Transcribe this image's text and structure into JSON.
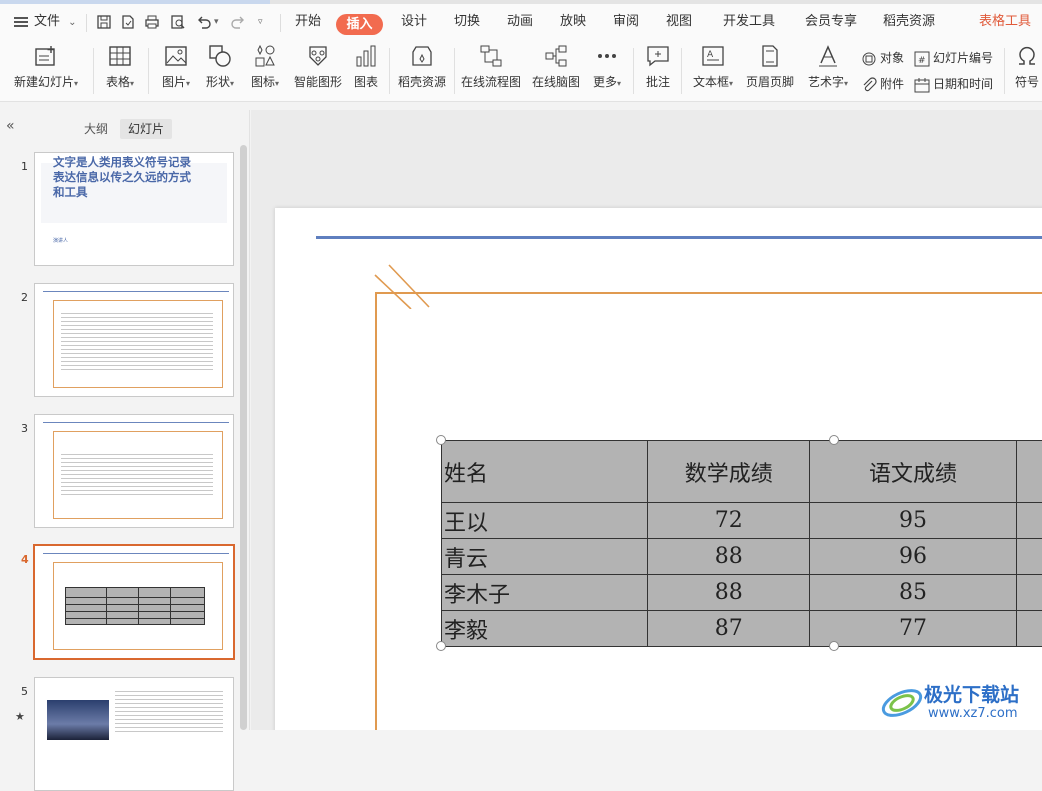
{
  "menu": {
    "file_label": "文件",
    "tabs": [
      "开始",
      "插入",
      "设计",
      "切换",
      "动画",
      "放映",
      "审阅",
      "视图",
      "开发工具",
      "会员专享",
      "稻壳资源",
      "表格工具"
    ],
    "active_tab": "插入"
  },
  "ribbon": {
    "new_slide": "新建幻灯片",
    "table": "表格",
    "picture": "图片",
    "shape": "形状",
    "icon": "图标",
    "smartart": "智能图形",
    "chart": "图表",
    "docer": "稻壳资源",
    "flowchart": "在线流程图",
    "mindmap": "在线脑图",
    "more": "更多",
    "comment": "批注",
    "textbox": "文本框",
    "header_footer": "页眉页脚",
    "wordart": "艺术字",
    "object": "对象",
    "attachment": "附件",
    "slide_number": "幻灯片编号",
    "datetime": "日期和时间",
    "symbol": "符号"
  },
  "panel": {
    "tab_outline": "大纲",
    "tab_slides": "幻灯片",
    "slide_numbers": [
      "1",
      "2",
      "3",
      "4",
      "5"
    ],
    "slide1_title": "文字是人类用表义符号记录表达信息以传之久远的方式和工具",
    "slide1_presenter": "演讲人"
  },
  "table": {
    "headers": [
      "姓名",
      "数学成绩",
      "语文成绩",
      ""
    ],
    "rows": [
      [
        "王以",
        "72",
        "95",
        ""
      ],
      [
        "青云",
        "88",
        "96",
        ""
      ],
      [
        "李木子",
        "88",
        "85",
        ""
      ],
      [
        "李毅",
        "87",
        "77",
        ""
      ]
    ]
  },
  "watermark": {
    "brand": "极光下载站",
    "url": "www.xz7.com"
  },
  "colors": {
    "accent_insert": "#f26b4f",
    "table_tools": "#e05a3a",
    "active_slide_border": "#d9682f",
    "slide_blue_line": "#5f7fbf",
    "slide_orange_frame": "#e09a50",
    "table_fill": "#b3b3b3"
  }
}
